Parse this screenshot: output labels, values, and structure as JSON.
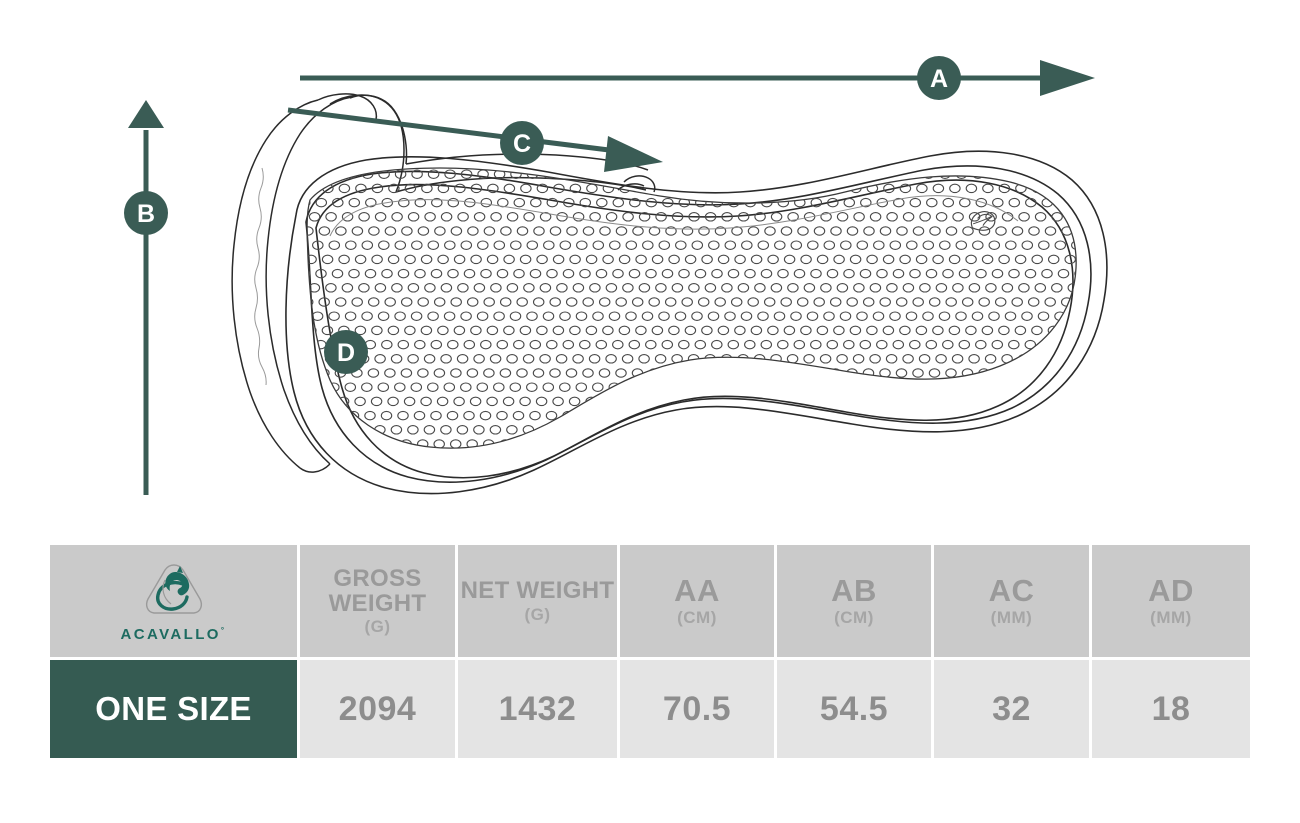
{
  "diagram": {
    "product": "gel saddle pad (half pad) technical drawing",
    "accent_color": "#3a5c55",
    "outline_color": "#2b2b2b",
    "markers": [
      {
        "id": "A",
        "label": "A",
        "direction": "horizontal-right",
        "描": "overall length arrow across top"
      },
      {
        "id": "B",
        "label": "B",
        "direction": "vertical-up",
        "描": "overall height arrow at left"
      },
      {
        "id": "C",
        "label": "C",
        "direction": "diagonal-right-down",
        "描": "thickness / front arrow"
      },
      {
        "id": "D",
        "label": "D",
        "direction": "point",
        "描": "gel insert thickness callout on pad"
      }
    ],
    "brand_mark": "acavallo-horse-head"
  },
  "table": {
    "brand": {
      "name": "ACAVALLO",
      "trademark": "°",
      "logo_color": "#1d6b60",
      "icon": "acavallo-horse-head-icon"
    },
    "columns": [
      {
        "key": "size",
        "title": "",
        "unit": ""
      },
      {
        "key": "gross_weight",
        "title": "GROSS WEIGHT",
        "unit": "(G)"
      },
      {
        "key": "net_weight",
        "title": "NET WEIGHT",
        "unit": "(G)"
      },
      {
        "key": "aa",
        "title": "AA",
        "unit": "(CM)"
      },
      {
        "key": "ab",
        "title": "AB",
        "unit": "(CM)"
      },
      {
        "key": "ac",
        "title": "AC",
        "unit": "(MM)"
      },
      {
        "key": "ad",
        "title": "AD",
        "unit": "(MM)"
      }
    ],
    "header": {
      "gross_weight_line1": "GROSS",
      "gross_weight_line2": "WEIGHT",
      "gross_weight_unit": "(G)",
      "net_weight_line1": "NET WEIGHT",
      "net_weight_unit": "(G)",
      "aa": "AA",
      "aa_unit": "(CM)",
      "ab": "AB",
      "ab_unit": "(CM)",
      "ac": "AC",
      "ac_unit": "(MM)",
      "ad": "AD",
      "ad_unit": "(MM)"
    },
    "rows": [
      {
        "size": "ONE SIZE",
        "gross_weight": "2094",
        "net_weight": "1432",
        "aa": "70.5",
        "ab": "54.5",
        "ac": "32",
        "ad": "18"
      }
    ],
    "colors": {
      "header_bg": "#cacaca",
      "header_text": "#9a9a9a",
      "value_bg": "#e4e4e4",
      "value_text": "#8d8d8d",
      "size_bg": "#355b52",
      "size_text": "#ffffff",
      "grid": "#ffffff"
    }
  }
}
